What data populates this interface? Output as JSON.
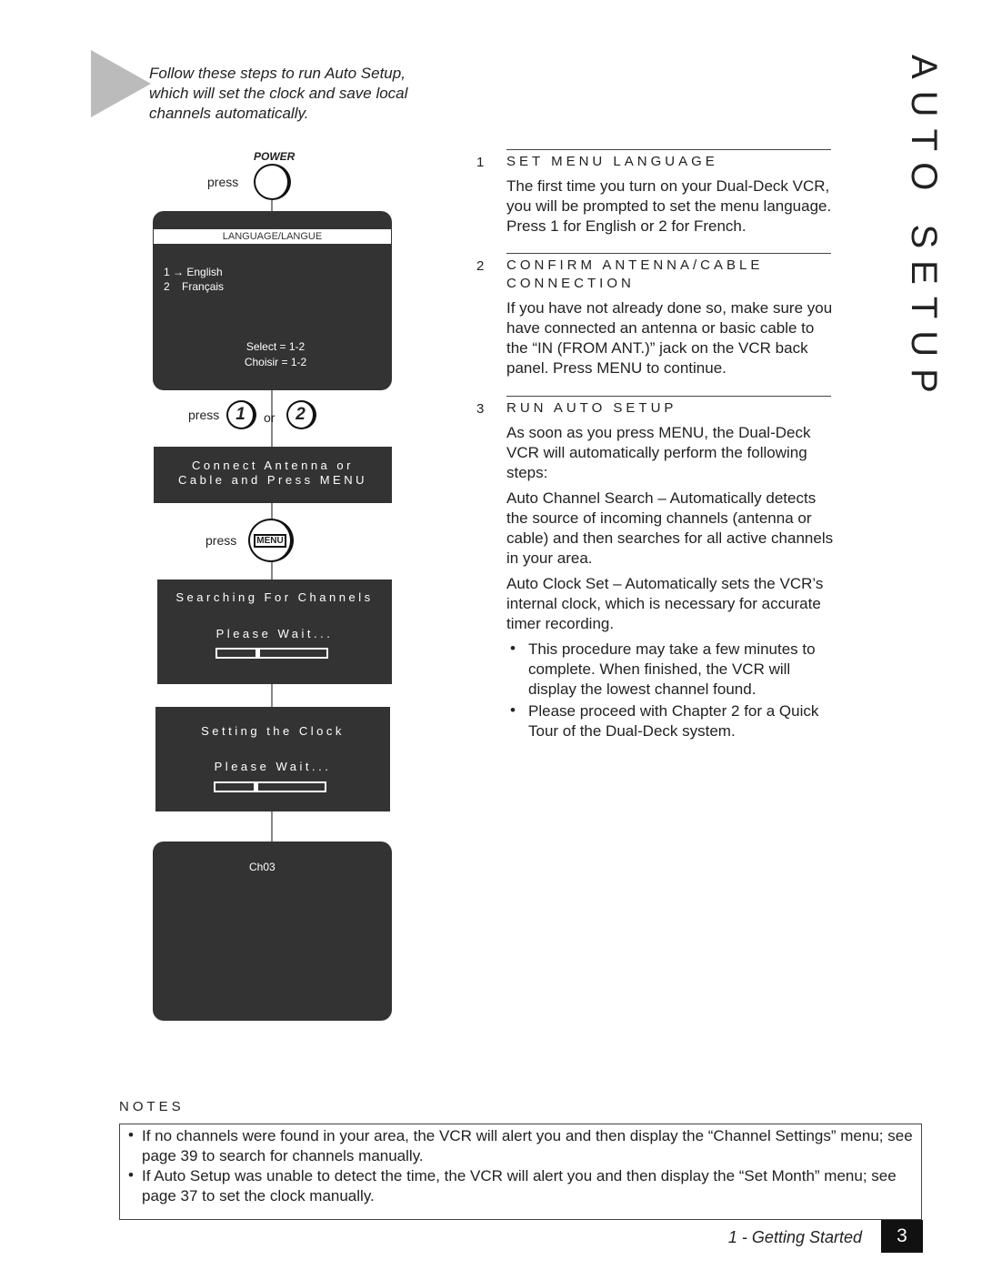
{
  "intro": "Follow these steps to run Auto Setup, which will set the clock and save local channels automatically.",
  "side_title": "AUTO SETUP",
  "diagram": {
    "power_label": "POWER",
    "press": "press",
    "or": "or",
    "button_1": "1",
    "button_2": "2",
    "menu_button": "MENU",
    "language_screen": {
      "title": "LANGUAGE/LANGUE",
      "option1_num": "1",
      "option1": "English",
      "option2_num": "2",
      "option2": "Français",
      "select": "Select = 1-2",
      "choisir": "Choisir = 1-2"
    },
    "connect_screen": {
      "line1": "Connect Antenna or",
      "line2": "Cable and Press MENU"
    },
    "search_screen": {
      "line1": "Searching For Channels",
      "line2": "Please Wait...",
      "progress": 0.37
    },
    "clock_screen": {
      "line1": "Setting the Clock",
      "line2": "Please Wait...",
      "progress": 0.37
    },
    "final_screen": {
      "channel": "Ch03"
    }
  },
  "steps": [
    {
      "num": "1",
      "heading": "SET MENU LANGUAGE",
      "body": "The first time you turn on your Dual-Deck VCR, you will be prompted to set the menu language. Press 1 for English or 2 for French."
    },
    {
      "num": "2",
      "heading": "CONFIRM ANTENNA/CABLE CONNECTION",
      "body": "If you have not already done so, make sure you have connected an antenna or basic cable to the “IN (FROM ANT.)” jack on the VCR back panel. Press MENU to continue."
    },
    {
      "num": "3",
      "heading": "RUN AUTO SETUP",
      "body": "As soon as you press MENU, the Dual-Deck VCR will automatically perform the following steps:",
      "para2": "Auto Channel Search – Automatically detects the source of incoming channels (antenna or cable) and then searches for all active channels in your area.",
      "para3": "Auto Clock Set – Automatically sets the VCR’s internal clock, which is necessary for accurate timer recording.",
      "bullets": [
        "This procedure may take a few minutes to complete. When finished, the VCR will display the lowest channel found.",
        "Please proceed with Chapter 2 for a Quick Tour of the Dual-Deck system."
      ]
    }
  ],
  "notes": {
    "heading": "NOTES",
    "items": [
      "If no channels were found in your area, the VCR will alert you and then display the “Channel Settings” menu; see page 39 to search for channels manually.",
      "If Auto Setup was unable to detect the time, the VCR will alert you and then display the “Set Month” menu; see page 37 to set the clock manually."
    ]
  },
  "footer": {
    "section": "1 - Getting Started",
    "page": "3"
  }
}
